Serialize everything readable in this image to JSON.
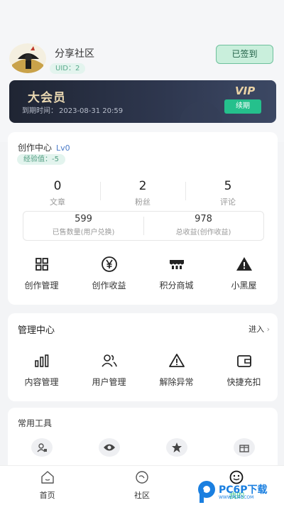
{
  "profile": {
    "name": "分享社区",
    "uid": "UID：2",
    "signed_label": "已签到"
  },
  "vip": {
    "title": "大会员",
    "expire_label": "到期时间：",
    "expire_time": "2023-08-31 20:59",
    "badge": "VIP",
    "renew_label": "续期"
  },
  "creator": {
    "title": "创作中心",
    "level": "Lv0",
    "exp": "经验值：-5",
    "stats": [
      {
        "value": "0",
        "label": "文章"
      },
      {
        "value": "2",
        "label": "粉丝"
      },
      {
        "value": "5",
        "label": "评论"
      }
    ],
    "sales": [
      {
        "value": "599",
        "label": "已售数量(用户兑换)"
      },
      {
        "value": "978",
        "label": "总收益(创作收益)"
      }
    ],
    "actions": [
      {
        "label": "创作管理",
        "icon": "grid-icon"
      },
      {
        "label": "创作收益",
        "icon": "yen-icon"
      },
      {
        "label": "积分商城",
        "icon": "shop-icon"
      },
      {
        "label": "小黑屋",
        "icon": "warning-filled-icon"
      }
    ]
  },
  "manage": {
    "title": "管理中心",
    "enter": "进入",
    "actions": [
      {
        "label": "内容管理",
        "icon": "bars-icon"
      },
      {
        "label": "用户管理",
        "icon": "users-icon"
      },
      {
        "label": "解除异常",
        "icon": "warning-icon"
      },
      {
        "label": "快捷充扣",
        "icon": "wallet-icon"
      }
    ]
  },
  "tools": {
    "title": "常用工具",
    "items": [
      {
        "icon": "user-card-icon"
      },
      {
        "icon": "eye-icon"
      },
      {
        "icon": "star-icon"
      },
      {
        "icon": "gift-icon"
      }
    ]
  },
  "nav": [
    {
      "label": "首页",
      "icon": "home-icon"
    },
    {
      "label": "社区",
      "icon": "community-icon"
    },
    {
      "label": "我的",
      "icon": "smile-icon"
    }
  ],
  "watermark": {
    "text": "PC6P下载",
    "sub": "WWW.PC6P.COM"
  },
  "colors": {
    "accent": "#2dbd85",
    "vip_bg": "#2a3246",
    "vip_gold": "#e9d8b2"
  }
}
